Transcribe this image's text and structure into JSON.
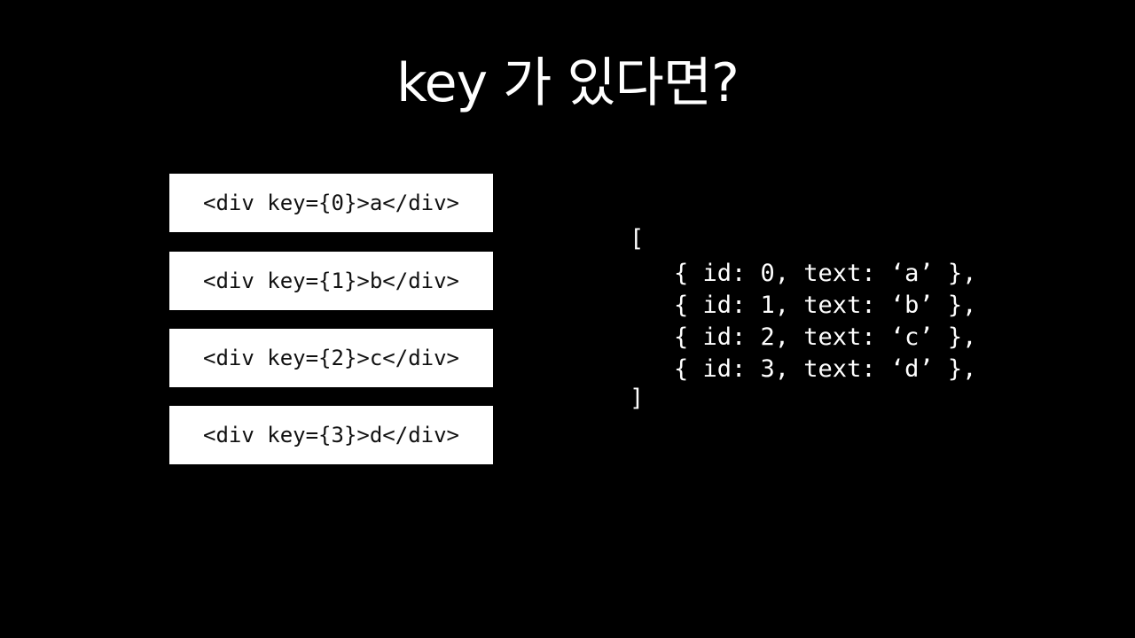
{
  "title": "key 가 있다면?",
  "elements": [
    "<div key={0}>a</div>",
    "<div key={1}>b</div>",
    "<div key={2}>c</div>",
    "<div key={3}>d</div>"
  ],
  "array": {
    "open": "[",
    "items": [
      "{ id: 0, text: ‘a’ },",
      "{ id: 1, text: ‘b’ },",
      "{ id: 2, text: ‘c’ },",
      "{ id: 3, text: ‘d’ },"
    ],
    "close": "]"
  },
  "colors": {
    "background": "#000000",
    "text": "#ffffff",
    "box": "#ffffff",
    "box_text": "#111111"
  }
}
